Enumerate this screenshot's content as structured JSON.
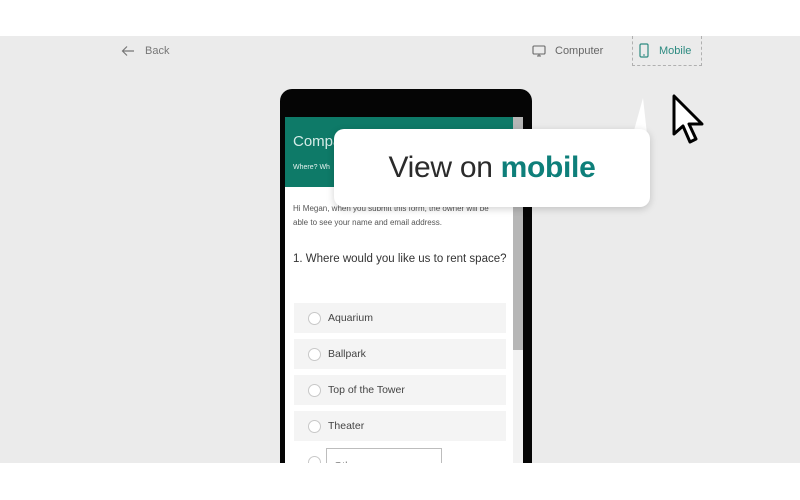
{
  "nav": {
    "back_label": "Back",
    "computer_label": "Computer",
    "mobile_label": "Mobile",
    "active_view": "Mobile",
    "accent_color": "#2c8a80"
  },
  "callout": {
    "text_prefix": "View on",
    "text_accent": "mobile",
    "accent_color": "#0e7f7a"
  },
  "form": {
    "title": "Compa",
    "subtitle": "Where? Wh",
    "header_color": "#0e7a68",
    "notice": "Hi Megan, when you submit this form, the owner will be able to see your name and email address.",
    "question": "1. Where would you like us to rent space?",
    "options": [
      {
        "label": "Aquarium"
      },
      {
        "label": "Ballpark"
      },
      {
        "label": "Top of the Tower"
      },
      {
        "label": "Theater"
      }
    ],
    "other_placeholder": "Other"
  }
}
